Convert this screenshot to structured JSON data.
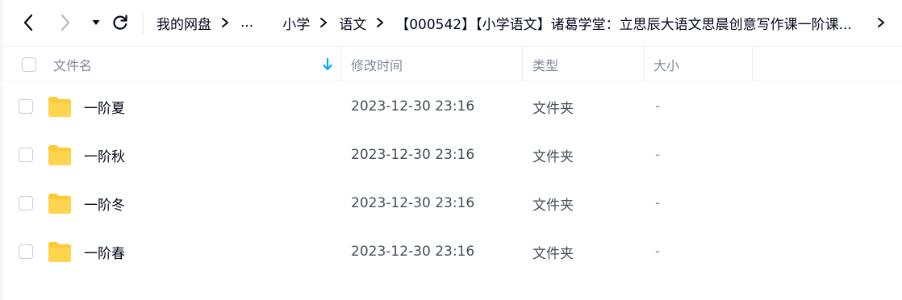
{
  "breadcrumbs": [
    "我的网盘",
    "...",
    "小学",
    "语文",
    "【000542】【小学语文】诸葛学堂：立思辰大语文思晨创意写作课一阶课..."
  ],
  "header": {
    "name_label": "文件名",
    "time_label": "修改时间",
    "type_label": "类型",
    "size_label": "大小"
  },
  "rows": [
    {
      "name": "一阶夏",
      "modified": "2023-12-30 23:16",
      "type": "文件夹",
      "size": "-"
    },
    {
      "name": "一阶秋",
      "modified": "2023-12-30 23:16",
      "type": "文件夹",
      "size": "-"
    },
    {
      "name": "一阶冬",
      "modified": "2023-12-30 23:16",
      "type": "文件夹",
      "size": "-"
    },
    {
      "name": "一阶春",
      "modified": "2023-12-30 23:16",
      "type": "文件夹",
      "size": "-"
    }
  ],
  "colors": {
    "text": "#03081a",
    "muted": "#818999",
    "sort_arrow": "#06a7ff",
    "folder": "#ffc933"
  },
  "icons": {
    "back": "chevron-left-icon",
    "forward": "chevron-right-icon",
    "dropdown": "caret-down-icon",
    "refresh": "refresh-icon",
    "separator": "chevron-right-icon",
    "sort": "sort-down-arrow-icon",
    "folder": "folder-icon"
  }
}
